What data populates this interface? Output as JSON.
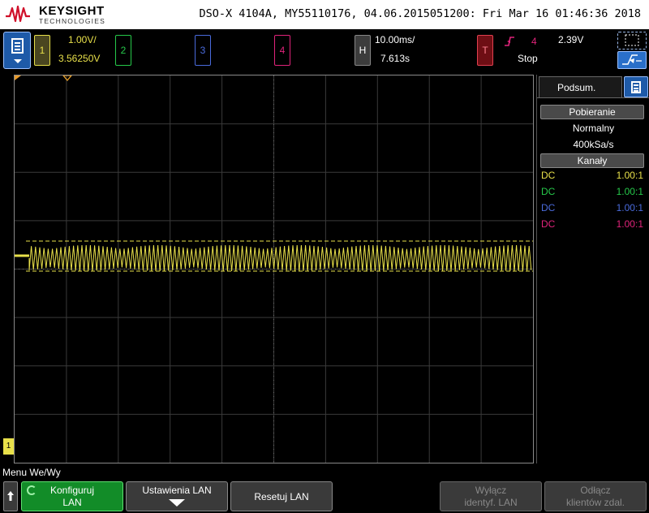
{
  "header": {
    "brand": "KEYSIGHT",
    "brand_sub": "TECHNOLOGIES",
    "title": "DSO-X 4104A, MY55110176, 04.06.2015051200: Fri Mar 16 01:46:36 2018"
  },
  "channels": {
    "ch1": {
      "label": "1",
      "scale": "1.00V/",
      "offset": "3.56250V"
    },
    "ch2": {
      "label": "2"
    },
    "ch3": {
      "label": "3"
    },
    "ch4": {
      "label": "4"
    }
  },
  "horizontal": {
    "label": "H",
    "timebase": "10.00ms/",
    "delay": "7.613s"
  },
  "trigger": {
    "label": "T",
    "source": "4",
    "level": "2.39V",
    "state": "Stop"
  },
  "side_panel": {
    "tab": "Podsum.",
    "acq_header": "Pobieranie",
    "acq_mode": "Normalny",
    "acq_rate": "400kSa/s",
    "channels_header": "Kanały",
    "rows": [
      {
        "coupling": "DC",
        "probe": "1.00:1",
        "color": "#e8e04a"
      },
      {
        "coupling": "DC",
        "probe": "1.00:1",
        "color": "#26c94a"
      },
      {
        "coupling": "DC",
        "probe": "1.00:1",
        "color": "#4a6bdc"
      },
      {
        "coupling": "DC",
        "probe": "1.00:1",
        "color": "#e0237a"
      }
    ]
  },
  "softkeys": {
    "menu_label": "Menu We/Wy",
    "key1_line1": "Konfiguruj",
    "key1_line2": "LAN",
    "key2": "Ustawienia LAN",
    "key3": "Resetuj LAN",
    "key4_line1": "Wyłącz",
    "key4_line2": "identyf. LAN",
    "key5_line1": "Odłącz",
    "key5_line2": "klientów zdal."
  },
  "colors": {
    "ch1": "#e8e04a",
    "ch2": "#26c94a",
    "ch3": "#4a6bdc",
    "ch4": "#e0237a"
  },
  "icons": {
    "menu": "document-icon",
    "trigger_edge": "rising-edge-icon"
  }
}
